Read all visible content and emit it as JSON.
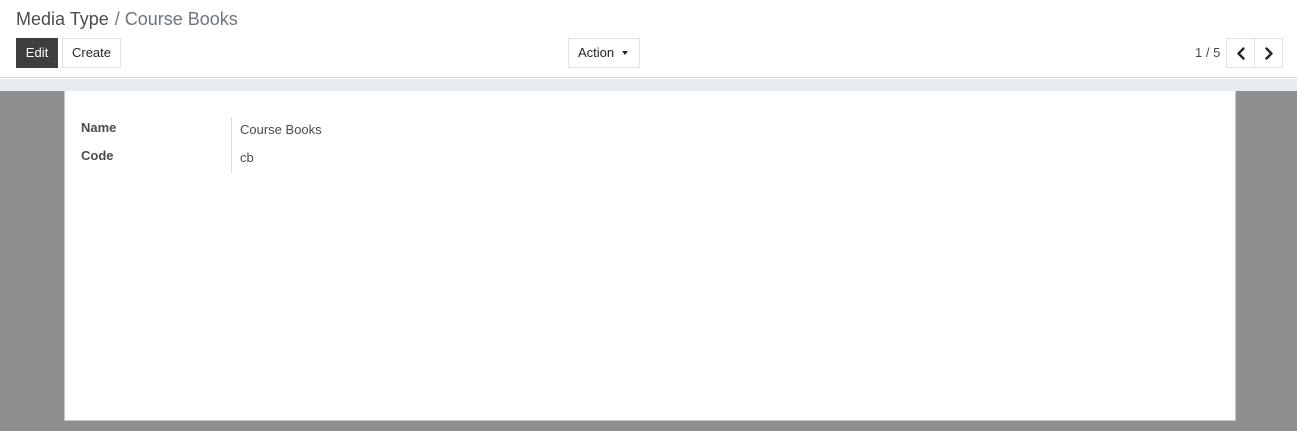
{
  "breadcrumb": {
    "parent": "Media Type",
    "separator": "/",
    "current": "Course Books"
  },
  "toolbar": {
    "edit_label": "Edit",
    "create_label": "Create",
    "action_label": "Action"
  },
  "pager": {
    "value": "1 / 5",
    "prev_icon": "chevron-left-icon",
    "next_icon": "chevron-right-icon"
  },
  "form": {
    "fields": [
      {
        "label": "Name",
        "value": "Course Books"
      },
      {
        "label": "Code",
        "value": "cb"
      }
    ]
  },
  "colors": {
    "primary_button": "#3e3e3e",
    "outer_background": "#8f8f8f",
    "sheet_background": "#ffffff"
  }
}
